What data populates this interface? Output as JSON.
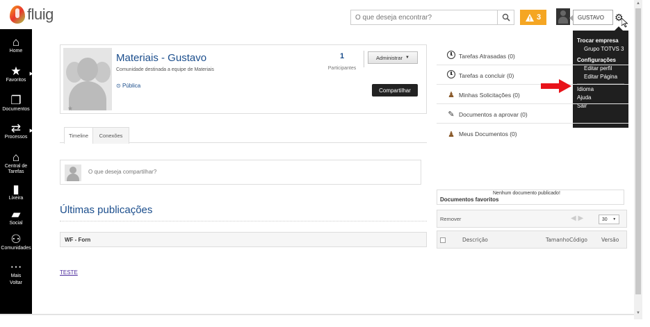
{
  "app": {
    "logo_text": "fluig"
  },
  "header": {
    "search_placeholder": "O que deseja encontrar?",
    "alert_count": "3",
    "user_name": "GUSTAVO"
  },
  "user_menu": {
    "trocar_empresa": "Trocar empresa",
    "empresa": "Grupo TOTVS 3",
    "configuracoes": "Configurações",
    "editar_perfil": "Editar perfil",
    "editar_pagina": "Editar Página",
    "idioma": "Idioma",
    "ajuda": "Ajuda",
    "sair": "Sair"
  },
  "sidebar": {
    "items": [
      {
        "label": "Home",
        "icon": "home-icon"
      },
      {
        "label": "Favoritos",
        "icon": "star-icon"
      },
      {
        "label": "Documentos",
        "icon": "documents-icon"
      },
      {
        "label": "Processos",
        "icon": "processes-icon"
      },
      {
        "label": "Central de Tarefas",
        "icon": "tasks-icon"
      },
      {
        "label": "Lixeira",
        "icon": "trash-icon"
      },
      {
        "label": "Social",
        "icon": "social-icon"
      },
      {
        "label": "Comunidades",
        "icon": "communities-icon"
      },
      {
        "label": "Mais",
        "icon": "more-icon"
      },
      {
        "label": "Voltar",
        "icon": "back-icon"
      }
    ]
  },
  "community": {
    "title": "Materiais - Gustavo",
    "description": "Comunidade destinada a equipe de Materiais",
    "visibility": "Pública",
    "participants_count": "1",
    "participants_label": "Participantes",
    "admin_button": "Administrar",
    "share_button": "Compartilhar"
  },
  "tabs": [
    "Timeline",
    "Conexões"
  ],
  "share_box": {
    "placeholder": "O que deseja compartilhar?"
  },
  "latest": {
    "title": "Últimas publicações",
    "row_title": "WF - Forn",
    "link": "TESTE"
  },
  "right_panel": {
    "tasks": [
      {
        "label": "Tarefas Atrasadas (0)",
        "icon": "clock-icon"
      },
      {
        "label": "Tarefas a concluir (0)",
        "icon": "clock-icon"
      },
      {
        "label": "Minhas Solicitações (0)",
        "icon": "person-icon"
      },
      {
        "label": "Documentos a aprovar (0)",
        "icon": "document-check-icon"
      },
      {
        "label": "Meus Documentos (0)",
        "icon": "person-icon"
      }
    ],
    "favorites": {
      "empty_msg": "Nenhum documento publicado!",
      "title": "Documentos favoritos"
    },
    "table": {
      "remove_label": "Remover",
      "page_size": "30",
      "columns": [
        "Descrição",
        "Tamanho",
        "Código",
        "Versão"
      ]
    }
  },
  "colors": {
    "sidebar_bg": "#000000",
    "alert_bg": "#f5a623",
    "title_blue": "#1a4d8c",
    "arrow_red": "#e8131a"
  }
}
